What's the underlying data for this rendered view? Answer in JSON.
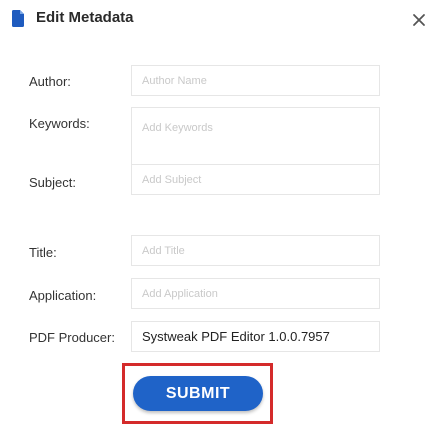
{
  "dialog": {
    "title": "Edit Metadata",
    "title_icon": "document-icon",
    "close_icon": "close-icon"
  },
  "fields": {
    "author": {
      "label": "Author:",
      "placeholder": "Author Name",
      "value": ""
    },
    "keywords": {
      "label": "Keywords:",
      "placeholder": "Add Keywords",
      "value": ""
    },
    "subject": {
      "label": "Subject:",
      "placeholder": "Add Subject",
      "value": ""
    },
    "title": {
      "label": "Title:",
      "placeholder": "Add Title",
      "value": ""
    },
    "application": {
      "label": "Application:",
      "placeholder": "Add Application",
      "value": ""
    },
    "producer": {
      "label": "PDF Producer:",
      "value": "Systweak PDF Editor 1.0.0.7957"
    }
  },
  "actions": {
    "submit_label": "SUBMIT"
  },
  "colors": {
    "accent": "#1f63c8",
    "highlight_frame": "#d42a2a",
    "icon": "#1e5bbf"
  }
}
